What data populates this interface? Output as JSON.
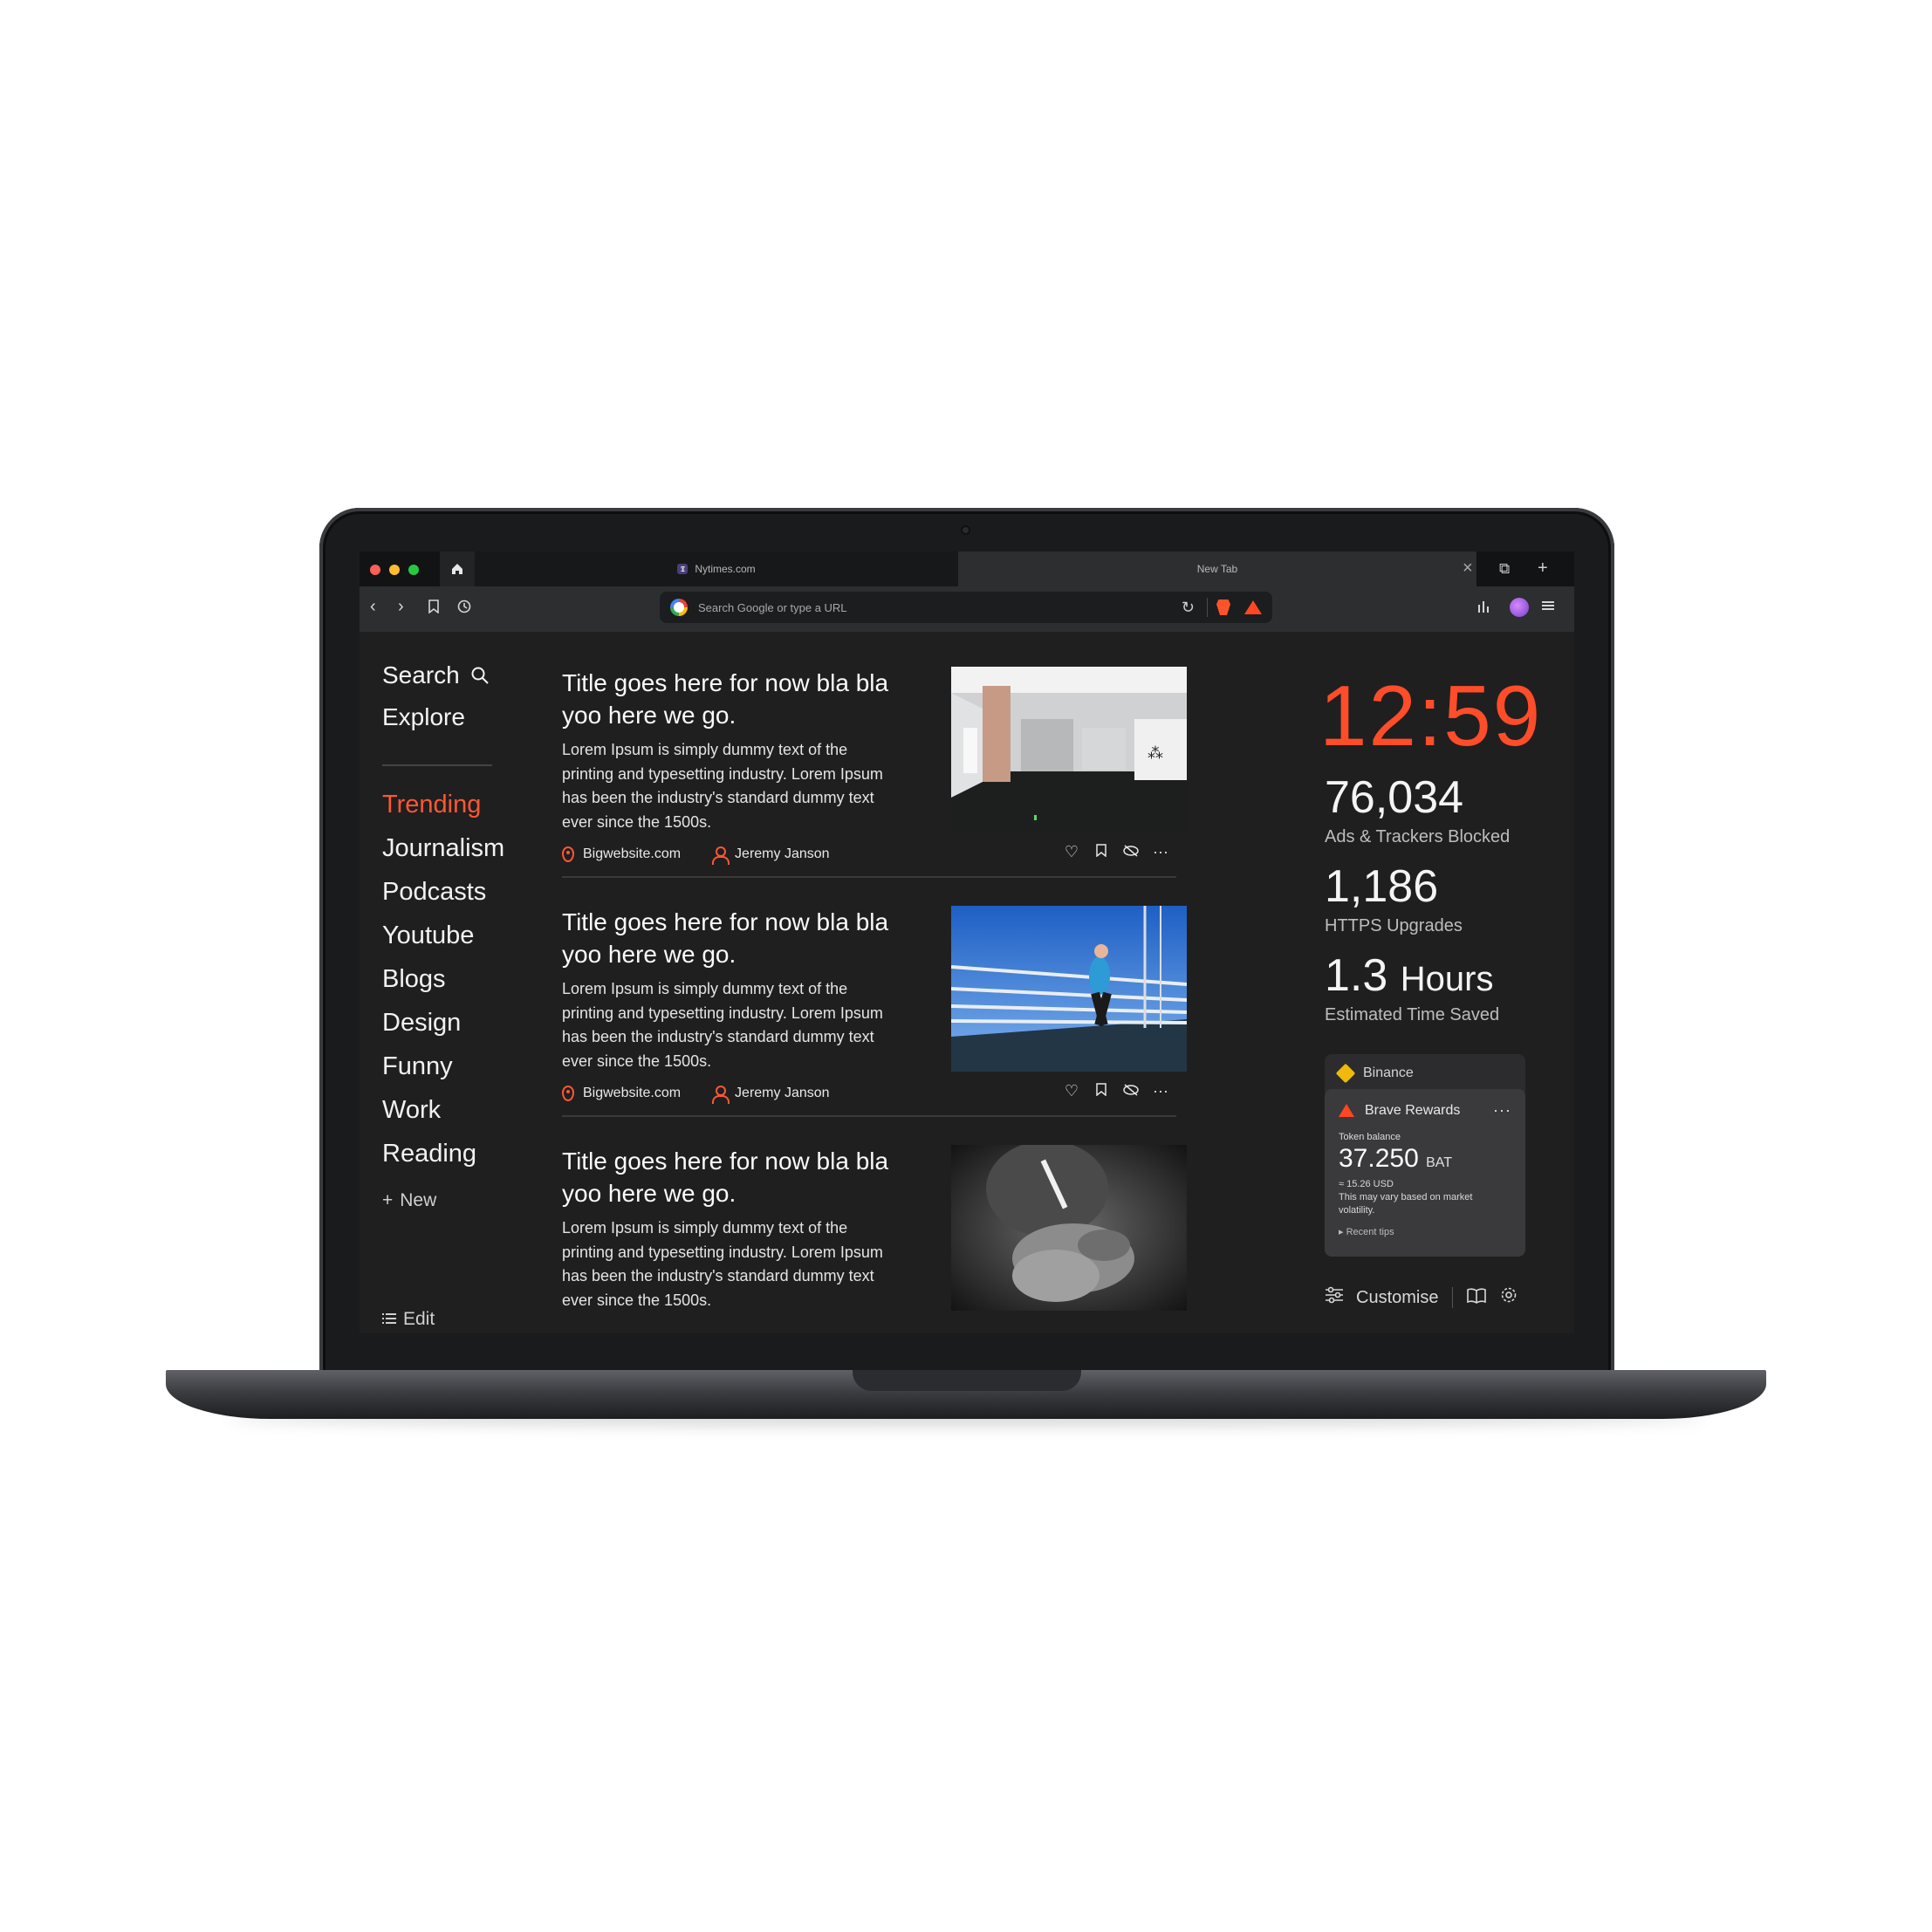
{
  "browser": {
    "tabs": [
      {
        "label": "Nytimes.com"
      },
      {
        "label": "New Tab"
      }
    ],
    "url_placeholder": "Search Google or type a URL"
  },
  "sidebar": {
    "search_label": "Search",
    "explore_label": "Explore",
    "items": [
      {
        "label": "Trending",
        "active": true
      },
      {
        "label": "Journalism"
      },
      {
        "label": "Podcasts"
      },
      {
        "label": "Youtube"
      },
      {
        "label": "Blogs"
      },
      {
        "label": "Design"
      },
      {
        "label": "Funny"
      },
      {
        "label": "Work"
      },
      {
        "label": "Reading"
      }
    ],
    "new_label": "New",
    "edit_label": "Edit"
  },
  "feed": {
    "articles": [
      {
        "title": "Title goes here for now bla bla yoo here we go.",
        "body": "Lorem Ipsum is simply dummy text of the printing and typesetting industry. Lorem Ipsum has been the industry's standard dummy text ever since the 1500s.",
        "source": "Bigwebsite.com",
        "author": "Jeremy Janson",
        "image": "gallery-room-photo"
      },
      {
        "title": "Title goes here for now bla bla yoo here we go.",
        "body": "Lorem Ipsum is simply dummy text of the printing and typesetting industry. Lorem Ipsum has been the industry's standard dummy text ever since the 1500s.",
        "source": "Bigwebsite.com",
        "author": "Jeremy Janson",
        "image": "runner-on-bridge-photo"
      },
      {
        "title": "Title goes here for now bla bla yoo here we go.",
        "body": "Lorem Ipsum is simply dummy text of the printing and typesetting industry. Lorem Ipsum has been the industry's standard dummy text ever since the 1500s.",
        "image": "lighting-cigarette-photo"
      }
    ]
  },
  "stats": {
    "clock": "12:59",
    "ads_blocked": "76,034",
    "ads_blocked_label": "Ads & Trackers Blocked",
    "https_upgrades": "1,186",
    "https_upgrades_label": "HTTPS Upgrades",
    "time_saved": "1.3",
    "time_saved_unit": "Hours",
    "time_saved_label": "Estimated Time Saved"
  },
  "widgets": {
    "binance_label": "Binance",
    "rewards_title": "Brave Rewards",
    "token_balance_label": "Token balance",
    "token_balance": "37.250",
    "token_currency": "BAT",
    "usd_value": "≈ 15.26 USD",
    "volatility_note": "This may vary based on market volatility.",
    "recent_tips": "Recent tips"
  },
  "footer": {
    "customise_label": "Customise"
  },
  "colors": {
    "accent": "#ff5733",
    "clock": "#ff4d29",
    "background": "#1f1f20"
  }
}
